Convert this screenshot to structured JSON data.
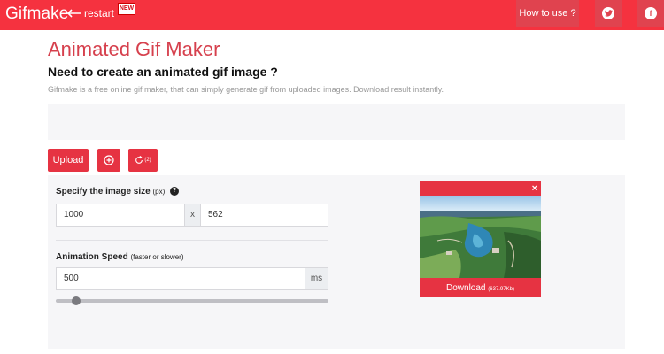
{
  "header": {
    "logo": "Gifmake",
    "restart_label": "restart",
    "new_badge": "NEW",
    "how_to_use": "How to use ?",
    "twitter_icon": "twitter-icon",
    "facebook_icon": "facebook-icon"
  },
  "main": {
    "title": "Animated Gif Maker",
    "subtitle": "Need to create an animated gif image ?",
    "description": "Gifmake is a free online gif maker, that can simply generate gif from uploaded images. Download result instantly."
  },
  "toolbar": {
    "upload_label": "Upload",
    "add_icon": "plus-circle-icon",
    "rotate_icon": "rotate-icon",
    "rotate_count": "(2)"
  },
  "settings": {
    "size_label": "Specify the image size",
    "size_unit": "(px)",
    "help_icon": "?",
    "width_value": "1000",
    "separator": "x",
    "height_value": "562",
    "speed_label": "Animation Speed",
    "speed_hint": "(faster or slower)",
    "speed_value": "500",
    "speed_unit": "ms",
    "slider_fraction": 0.06
  },
  "preview": {
    "close": "×",
    "download_label": "Download",
    "download_size": "(637.97Kb)"
  },
  "colors": {
    "brand_red": "#f5323f",
    "button_red": "#e63342",
    "title_red": "#d6404d"
  }
}
